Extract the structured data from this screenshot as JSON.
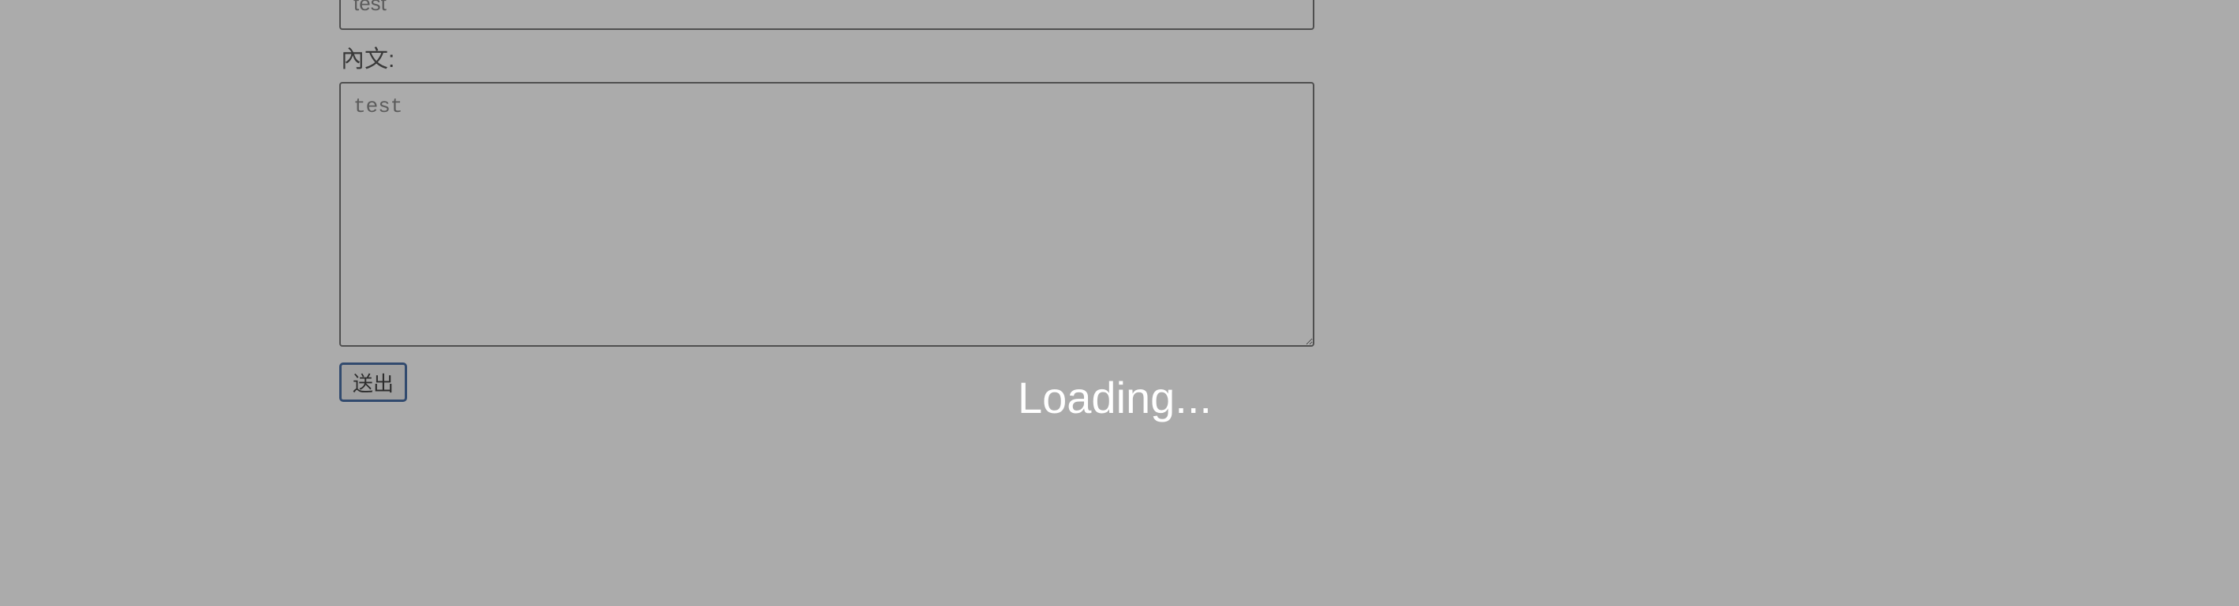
{
  "form": {
    "title_value": "test",
    "content_label": "內文:",
    "content_value": "test",
    "submit_label": "送出"
  },
  "overlay": {
    "loading_text": "Loading..."
  },
  "colors": {
    "overlay": "#aaaaaa",
    "loading_text": "#ffffff",
    "button_border": "#4a6fa5"
  }
}
